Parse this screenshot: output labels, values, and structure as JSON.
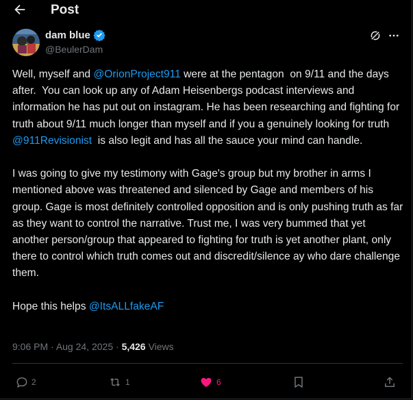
{
  "header": {
    "title": "Post"
  },
  "author": {
    "name": "dam blue",
    "handle": "@BeulerDam"
  },
  "body": {
    "p1": [
      "Well, myself and ",
      "@OrionProject911",
      " were at the pentagon  on 9/11 and the days after.  You can look up any of Adam Heisenbergs podcast interviews and information he has put out on instagram. He has been researching and fighting for truth about 9/11 much longer than myself and if you a genuinely looking for truth ",
      "@911Revisionist",
      "  is also legit and has all the sauce your mind can handle."
    ],
    "p2": "I was going to give my testimony with Gage's group but my brother in arms I mentioned above was threatened and silenced by Gage and members of his group. Gage is most definitely controlled opposition and is only pushing truth as far as they want to control the narrative. Trust me, I was very bummed that yet another person/group that appeared to fighting for truth is yet another plant, only there to control which truth comes out and discredit/silence ay who dare challenge them.",
    "p3": [
      "Hope this helps ",
      "@ItsALLfakeAF"
    ]
  },
  "meta": {
    "time": "9:06 PM",
    "sep": " · ",
    "date": "Aug 24, 2025",
    "views_count": "5,426",
    "views_label": " Views"
  },
  "actions": {
    "replies": "2",
    "reposts": "1",
    "likes": "6"
  },
  "colors": {
    "link": "#1d9bf0",
    "like": "#f91880",
    "muted": "#71767b"
  }
}
